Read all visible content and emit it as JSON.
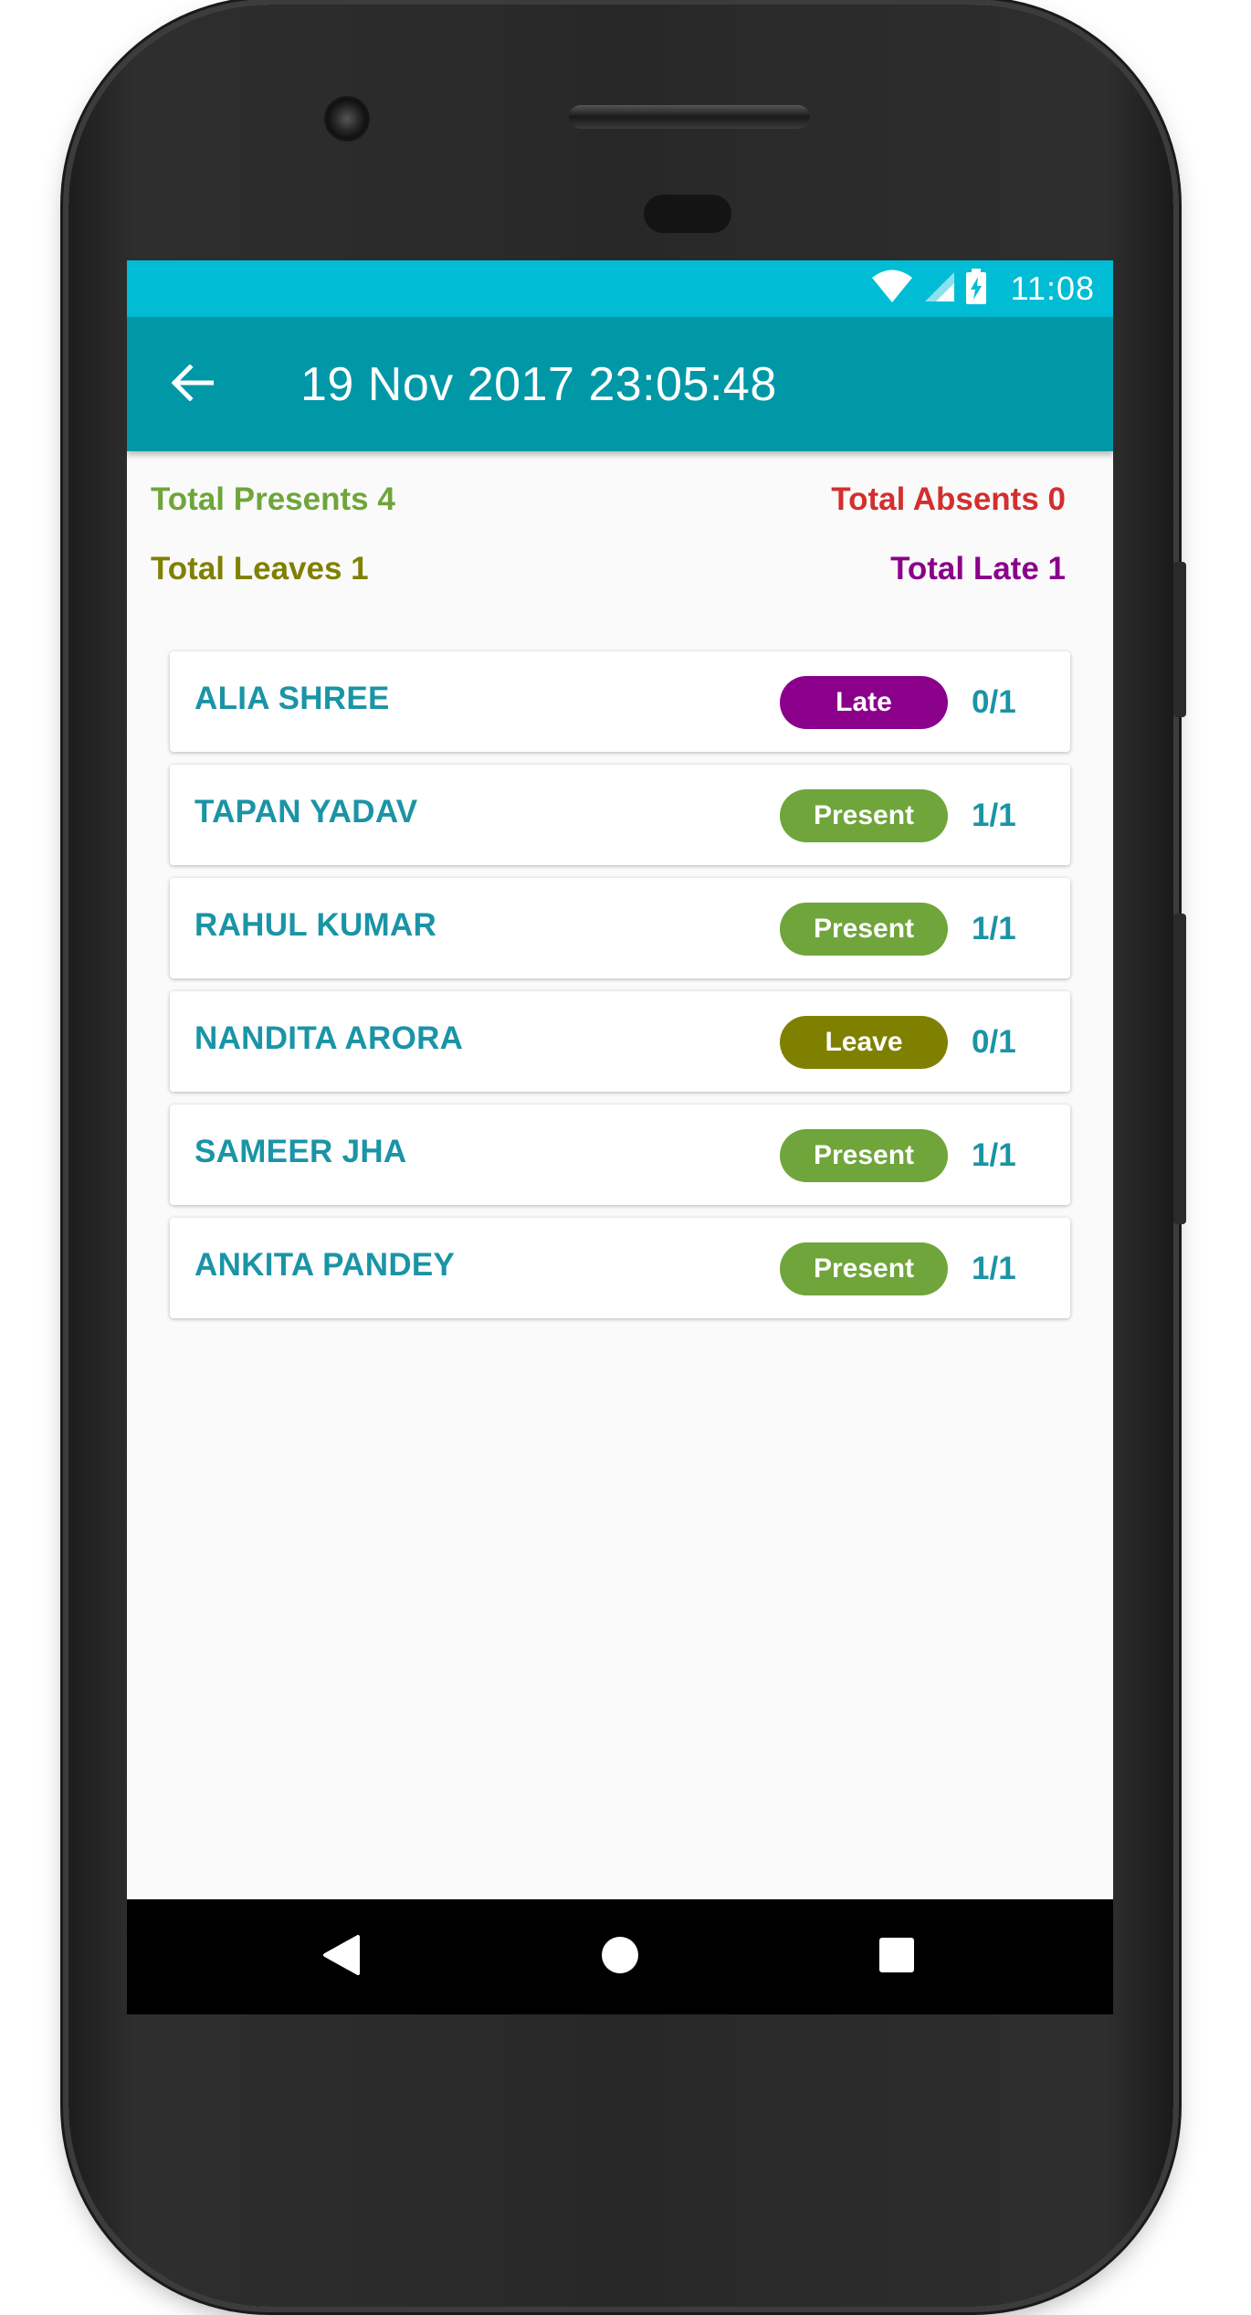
{
  "status_bar": {
    "time": "11:08"
  },
  "app_bar": {
    "title": "19 Nov 2017 23:05:48"
  },
  "summary": {
    "presents": "Total Presents 4",
    "absents": "Total Absents 0",
    "leaves": "Total Leaves 1",
    "late": "Total Late 1"
  },
  "colors": {
    "status_bar": "#00bcd4",
    "app_bar": "#0097a7",
    "present": "#6fa53a",
    "absent": "#d32f2f",
    "leave": "#808000",
    "late": "#8b008b",
    "name_text": "#1a94a6"
  },
  "students": [
    {
      "name": "ALIA SHREE",
      "status": "Late",
      "score": "0/1",
      "status_color": "#8b008b"
    },
    {
      "name": "TAPAN YADAV",
      "status": "Present",
      "score": "1/1",
      "status_color": "#6fa53a"
    },
    {
      "name": "RAHUL KUMAR",
      "status": "Present",
      "score": "1/1",
      "status_color": "#6fa53a"
    },
    {
      "name": "NANDITA ARORA",
      "status": "Leave",
      "score": "0/1",
      "status_color": "#808000"
    },
    {
      "name": "SAMEER JHA",
      "status": "Present",
      "score": "1/1",
      "status_color": "#6fa53a"
    },
    {
      "name": "ANKITA PANDEY",
      "status": "Present",
      "score": "1/1",
      "status_color": "#6fa53a"
    }
  ],
  "icons": {
    "back": "arrow-left",
    "wifi": "wifi",
    "signal": "cell-signal",
    "battery": "battery-charging",
    "nav_back": "triangle-back",
    "nav_home": "circle-home",
    "nav_recents": "square-recents"
  }
}
